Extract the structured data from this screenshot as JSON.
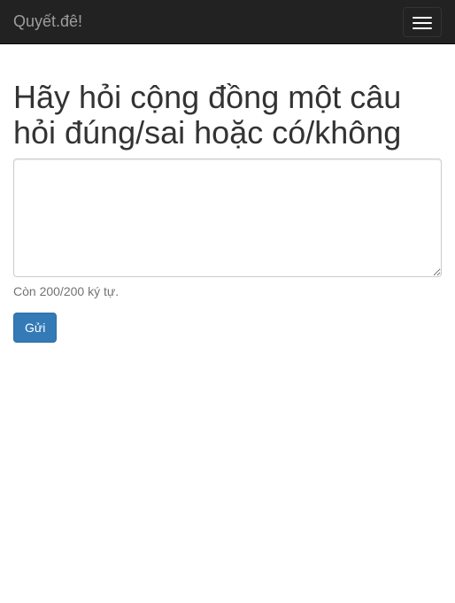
{
  "navbar": {
    "brand": "Quyết.đê!",
    "toggle_icon": "hamburger-menu-icon"
  },
  "main": {
    "heading": "Hãy hỏi cộng đồng một câu hỏi đúng/sai hoặc có/không",
    "question_value": "",
    "char_counter": "Còn 200/200 ký tự.",
    "submit_label": "Gửi"
  },
  "colors": {
    "navbar_bg": "#222222",
    "brand_text": "#9d9d9d",
    "primary_button": "#337ab7"
  }
}
